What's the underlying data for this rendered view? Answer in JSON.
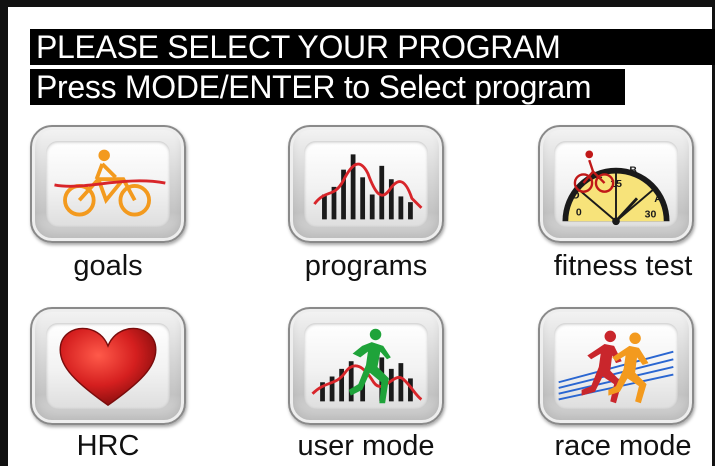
{
  "header": {
    "line1": "PLEASE SELECT YOUR PROGRAM",
    "line2": "Press MODE/ENTER to Select program"
  },
  "colors": {
    "header_bg": "#000000",
    "header_text": "#ffffff",
    "bike_orange": "#f39a1e",
    "heart_red": "#d51f1f",
    "runner_green": "#1fa33a",
    "curve_red": "#d8252a"
  },
  "programs": [
    {
      "id": "goals",
      "label": "goals",
      "icon": "bicycle-rider-icon"
    },
    {
      "id": "programs",
      "label": "programs",
      "icon": "bar-graph-profile-icon"
    },
    {
      "id": "fitness_test",
      "label": "fitness test",
      "icon": "speedometer-gauge-icon"
    },
    {
      "id": "hrc",
      "label": "HRC",
      "icon": "heart-icon"
    },
    {
      "id": "user_mode",
      "label": "user mode",
      "icon": "runner-on-graph-icon"
    },
    {
      "id": "race_mode",
      "label": "race mode",
      "icon": "two-runners-icon"
    }
  ],
  "gauge": {
    "scale_labels": [
      "0",
      "15",
      "30"
    ],
    "zone_labels": [
      "B",
      "C",
      "D",
      "A"
    ]
  }
}
